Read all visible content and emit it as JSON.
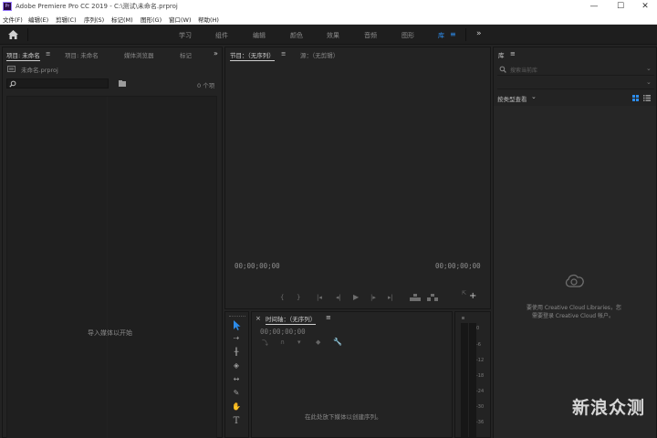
{
  "app": {
    "logo_text": "Pr",
    "window_title": "Adobe Premiere Pro CC 2019 - C:\\测试\\未命名.prproj",
    "window_controls": [
      "—",
      "☐",
      "✕"
    ]
  },
  "menu": [
    "文件(F)",
    "编辑(E)",
    "剪辑(C)",
    "序列(S)",
    "标记(M)",
    "图形(G)",
    "窗口(W)",
    "帮助(H)"
  ],
  "workspaces": {
    "items": [
      "学习",
      "组件",
      "编辑",
      "颜色",
      "效果",
      "音频",
      "图形",
      "库"
    ],
    "active": "库",
    "more": "»"
  },
  "project_panel": {
    "tabs": [
      "项目: 未命名",
      "项目: 未命名",
      "媒体浏览器",
      "标记"
    ],
    "project_file": "未命名.prproj",
    "search_placeholder": "",
    "item_count": "0 个项",
    "empty_message": "导入媒体以开始"
  },
  "program_panel": {
    "tabs": [
      "节目：（无序列）",
      "源：（无剪辑）"
    ],
    "timecode_left": "00;00;00;00",
    "timecode_right": "00;00;00;00"
  },
  "timeline_panel": {
    "title": "时间轴：（无序列）",
    "timecode": "00;00;00;00",
    "empty_message": "在此处放下媒体以创建序列。"
  },
  "audio_meter": {
    "ticks": [
      "0",
      "-6",
      "-12",
      "-18",
      "-24",
      "-30",
      "-36"
    ]
  },
  "libraries_panel": {
    "tab": "库",
    "search_placeholder": "搜索当前库",
    "view_label": "按类型查看",
    "message_line1": "要使用 Creative Cloud Libraries，您",
    "message_line2": "需要登录 Creative Cloud 帐户。"
  },
  "watermark": "新浪众测",
  "colors": {
    "accent": "#2d8ceb",
    "panel_bg": "#232323",
    "dark_bg": "#1e1e1e"
  }
}
